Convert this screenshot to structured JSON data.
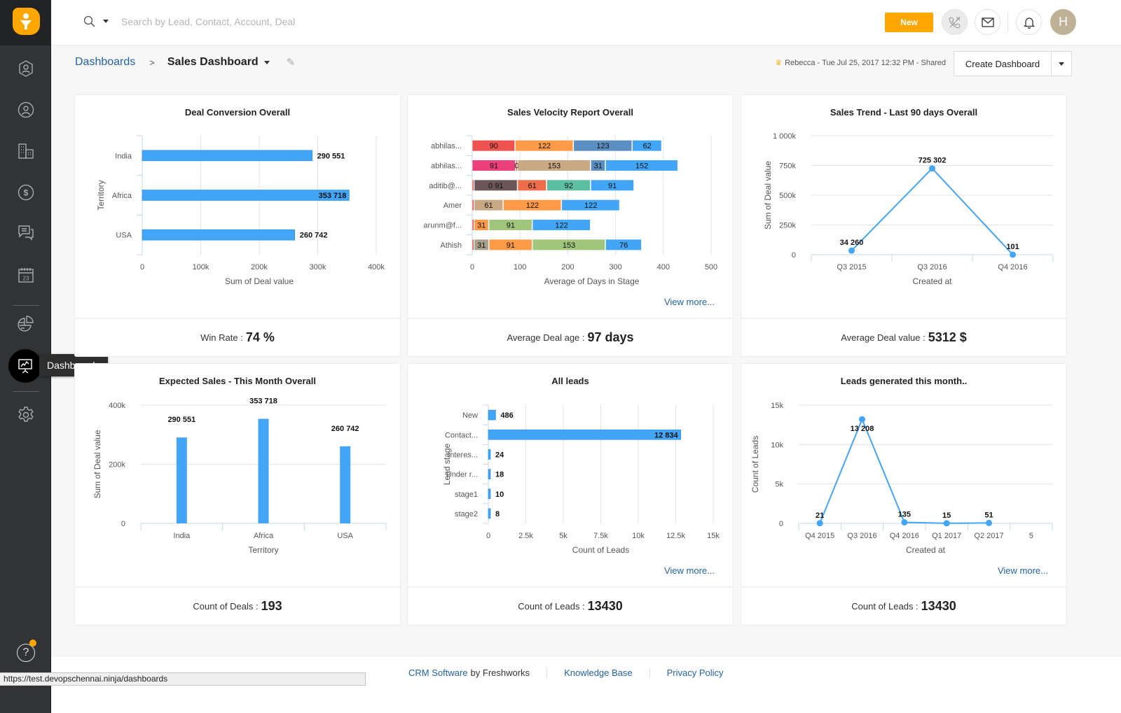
{
  "app": {
    "brand_color": "#ffa600",
    "link_color": "#2163a3",
    "bar_color": "#42a5f5"
  },
  "search": {
    "placeholder": "Search by Lead, Contact, Account, Deal",
    "value": ""
  },
  "topbar": {
    "new_label": "New",
    "avatar_initial": "H",
    "icons": [
      "phone-off-icon",
      "mail-icon",
      "bell-icon"
    ]
  },
  "sidebar": {
    "items": [
      {
        "name": "leads",
        "icon": "lead-icon"
      },
      {
        "name": "contacts",
        "icon": "contact-icon"
      },
      {
        "name": "accounts",
        "icon": "building-icon"
      },
      {
        "name": "deals",
        "icon": "dollar-icon"
      },
      {
        "name": "conversations",
        "icon": "chat-icon"
      },
      {
        "name": "calendar",
        "icon": "calendar-icon",
        "date": "23"
      },
      {
        "name": "reports",
        "icon": "pie-chart-icon"
      },
      {
        "name": "dashboards",
        "icon": "presentation-icon",
        "active": true
      },
      {
        "name": "settings",
        "icon": "gear-icon"
      }
    ],
    "tooltip": "Dashboards",
    "help": "?"
  },
  "breadcrumb": {
    "root": "Dashboards",
    "separator": ">",
    "current": "Sales Dashboard"
  },
  "meta": {
    "text": "Rebecca - Tue Jul 25, 2017 12:32 PM - Shared"
  },
  "create": {
    "label": "Create Dashboard"
  },
  "cards": [
    {
      "title": "Deal Conversion Overall",
      "footer_label": "Win Rate :",
      "footer_value": "74 %"
    },
    {
      "title": "Sales Velocity Report Overall",
      "footer_label": "Average Deal age :",
      "footer_value": "97 days",
      "view_more": "View more..."
    },
    {
      "title": "Sales Trend - Last 90 days Overall",
      "footer_label": "Average Deal value :",
      "footer_value": "5312 $"
    },
    {
      "title": "Expected Sales - This Month Overall",
      "footer_label": "Count of Deals :",
      "footer_value": "193"
    },
    {
      "title": "All leads",
      "footer_label": "Count of Leads :",
      "footer_value": "13430",
      "view_more": "View more..."
    },
    {
      "title": "Leads generated this month..",
      "footer_label": "Count of Leads :",
      "footer_value": "13430",
      "view_more": "View more..."
    }
  ],
  "chart_data": [
    {
      "type": "bar",
      "orientation": "horizontal",
      "title": "Deal Conversion Overall",
      "categories": [
        "India",
        "Africa",
        "USA"
      ],
      "values": [
        290551,
        353718,
        260742
      ],
      "labels": [
        "290 551",
        "353 718",
        "260 742"
      ],
      "xlabel": "Sum of Deal value",
      "ylabel": "Territory",
      "xlim": [
        0,
        400000
      ],
      "ticks": [
        "0",
        "100k",
        "200k",
        "300k",
        "400k"
      ],
      "grid": true
    },
    {
      "type": "bar",
      "orientation": "horizontal",
      "stacked": true,
      "title": "Sales Velocity Report Overall",
      "categories": [
        "abhilas...",
        "abhilas...",
        "aditib@...",
        "Amer",
        "arunm@f...",
        "Athish"
      ],
      "rows": [
        [
          {
            "v": 90,
            "c": "#ee5350",
            "l": "90"
          },
          {
            "v": 122,
            "c": "#ff9a48",
            "l": "122"
          },
          {
            "v": 123,
            "c": "#5b8ec2",
            "l": "123"
          },
          {
            "v": 62,
            "c": "#42a5f5",
            "l": "62"
          }
        ],
        [
          {
            "v": 91,
            "c": "#ec407a",
            "l": "91"
          },
          {
            "v": 4,
            "c": "#ef6b5e",
            "l": "0"
          },
          {
            "v": 153,
            "c": "#c8a983",
            "l": "153"
          },
          {
            "v": 31,
            "c": "#5b8ec2",
            "l": "31"
          },
          {
            "v": 152,
            "c": "#42a5f5",
            "l": "152"
          }
        ],
        [
          {
            "v": 4,
            "c": "#ee5350",
            "l": ""
          },
          {
            "v": 91,
            "c": "#6d5659",
            "l": "0  91"
          },
          {
            "v": 61,
            "c": "#ee6d4a",
            "l": "61"
          },
          {
            "v": 92,
            "c": "#5cc0a0",
            "l": "92"
          },
          {
            "v": 91,
            "c": "#42a5f5",
            "l": "91"
          }
        ],
        [
          {
            "v": 4,
            "c": "#ee5350",
            "l": ""
          },
          {
            "v": 61,
            "c": "#c8a983",
            "l": "61"
          },
          {
            "v": 122,
            "c": "#ff9a48",
            "l": "122"
          },
          {
            "v": 122,
            "c": "#42a5f5",
            "l": "122"
          }
        ],
        [
          {
            "v": 4,
            "c": "#ee5350",
            "l": ""
          },
          {
            "v": 31,
            "c": "#ff9a48",
            "l": "31"
          },
          {
            "v": 91,
            "c": "#9fc67a",
            "l": "91"
          },
          {
            "v": 122,
            "c": "#42a5f5",
            "l": "122"
          }
        ],
        [
          {
            "v": 4,
            "c": "#ee5350",
            "l": ""
          },
          {
            "v": 31,
            "c": "#a89f8a",
            "l": "31"
          },
          {
            "v": 91,
            "c": "#ff9a48",
            "l": "91"
          },
          {
            "v": 153,
            "c": "#9fc67a",
            "l": "153"
          },
          {
            "v": 76,
            "c": "#42a5f5",
            "l": "76"
          }
        ]
      ],
      "xlabel": "Average of Days in Stage",
      "xlim": [
        0,
        500
      ],
      "ticks": [
        "0",
        "100",
        "200",
        "300",
        "400",
        "500"
      ],
      "grid": true
    },
    {
      "type": "line",
      "title": "Sales Trend - Last 90 days Overall",
      "categories": [
        "Q3 2015",
        "Q3 2016",
        "Q4 2016"
      ],
      "values": [
        34260,
        725302,
        101
      ],
      "labels": [
        "34 260",
        "725 302",
        "101"
      ],
      "xlabel": "Created at",
      "ylabel": "Sum of Deal value",
      "ylim": [
        0,
        1000000
      ],
      "ticks": [
        "0",
        "250k",
        "500k",
        "750k",
        "1 000k"
      ],
      "grid": true
    },
    {
      "type": "bar",
      "orientation": "vertical",
      "title": "Expected Sales - This Month Overall",
      "categories": [
        "India",
        "Africa",
        "USA"
      ],
      "values": [
        290551,
        353718,
        260742
      ],
      "labels": [
        "290 551",
        "353 718",
        "260 742"
      ],
      "xlabel": "Territory",
      "ylabel": "Sum of Deal value",
      "ylim": [
        0,
        400000
      ],
      "ticks": [
        "0",
        "200k",
        "400k"
      ],
      "grid": true
    },
    {
      "type": "bar",
      "orientation": "horizontal",
      "title": "All leads",
      "categories": [
        "New",
        "Contact...",
        "Interes...",
        "Under r...",
        "stage1",
        "stage2"
      ],
      "values": [
        486,
        12834,
        24,
        18,
        10,
        8
      ],
      "labels": [
        "486",
        "12 834",
        "24",
        "18",
        "10",
        "8"
      ],
      "xlabel": "Count of Leads",
      "ylabel": "Lead stage",
      "xlim": [
        0,
        15000
      ],
      "ticks": [
        "0",
        "2.5k",
        "5k",
        "7.5k",
        "10k",
        "12.5k",
        "15k"
      ],
      "grid": true
    },
    {
      "type": "line",
      "title": "Leads generated this month..",
      "categories": [
        "Q4 2015",
        "Q3 2016",
        "Q4 2016",
        "Q1 2017",
        "Q2 2017",
        "5"
      ],
      "values": [
        21,
        13208,
        135,
        15,
        51,
        null
      ],
      "labels": [
        "21",
        "13 208",
        "135",
        "15",
        "51",
        ""
      ],
      "xlabel": "Created at",
      "ylabel": "Count of Leads",
      "ylim": [
        0,
        15000
      ],
      "ticks": [
        "0",
        "5k",
        "10k",
        "15k"
      ],
      "grid": true
    }
  ],
  "footer": {
    "crm_link": "CRM Software",
    "by": "by Freshworks",
    "kb": "Knowledge Base",
    "privacy": "Privacy Policy"
  },
  "status_url": "https://test.devopschennai.ninja/dashboards"
}
